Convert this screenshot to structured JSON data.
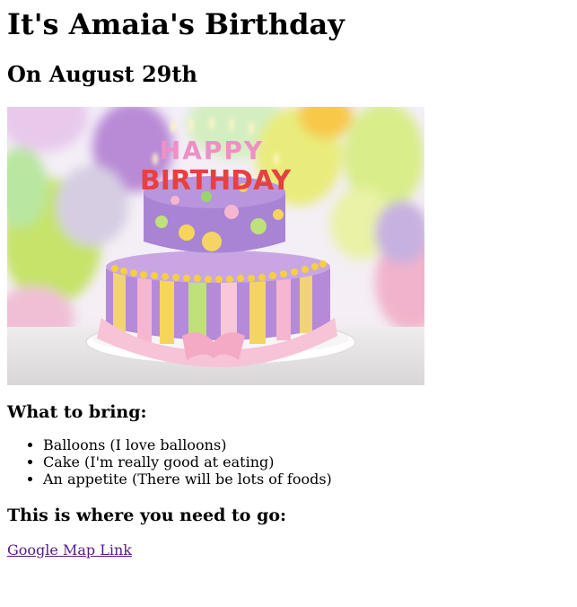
{
  "page": {
    "title": "It's Amaia's Birthday",
    "date": "On August 29th"
  },
  "image": {
    "cake_text_top": "HAPPY",
    "cake_text_bottom": "BIRTHDAY"
  },
  "bring": {
    "heading": "What to bring:",
    "items": [
      "Balloons (I love balloons)",
      "Cake (I'm really good at eating)",
      "An appetite (There will be lots of foods)"
    ]
  },
  "directions": {
    "heading": "This is where you need to go:",
    "link_label": "Google Map Link"
  },
  "colors": {
    "link": "#551a8b",
    "text": "#000000",
    "background": "#ffffff"
  }
}
